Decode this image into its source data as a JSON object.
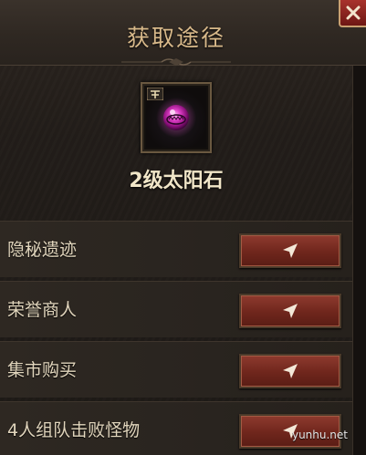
{
  "dialog": {
    "title": "获取途径",
    "close_icon": "close-x-icon"
  },
  "item": {
    "name": "2级太阳石",
    "icon": "purple-orb-gem-icon",
    "badge_icon": "grade-badge-icon"
  },
  "sources": [
    {
      "label": "隐秘遗迹",
      "action_icon": "navigate-arrow-icon"
    },
    {
      "label": "荣誉商人",
      "action_icon": "navigate-arrow-icon"
    },
    {
      "label": "集市购买",
      "action_icon": "navigate-arrow-icon"
    },
    {
      "label": "4人组队击败怪物",
      "action_icon": "navigate-arrow-icon"
    }
  ],
  "watermark": "yunhu.net",
  "colors": {
    "title": "#d8b98a",
    "button": "#7a2e22",
    "gem": "#e040c8"
  }
}
